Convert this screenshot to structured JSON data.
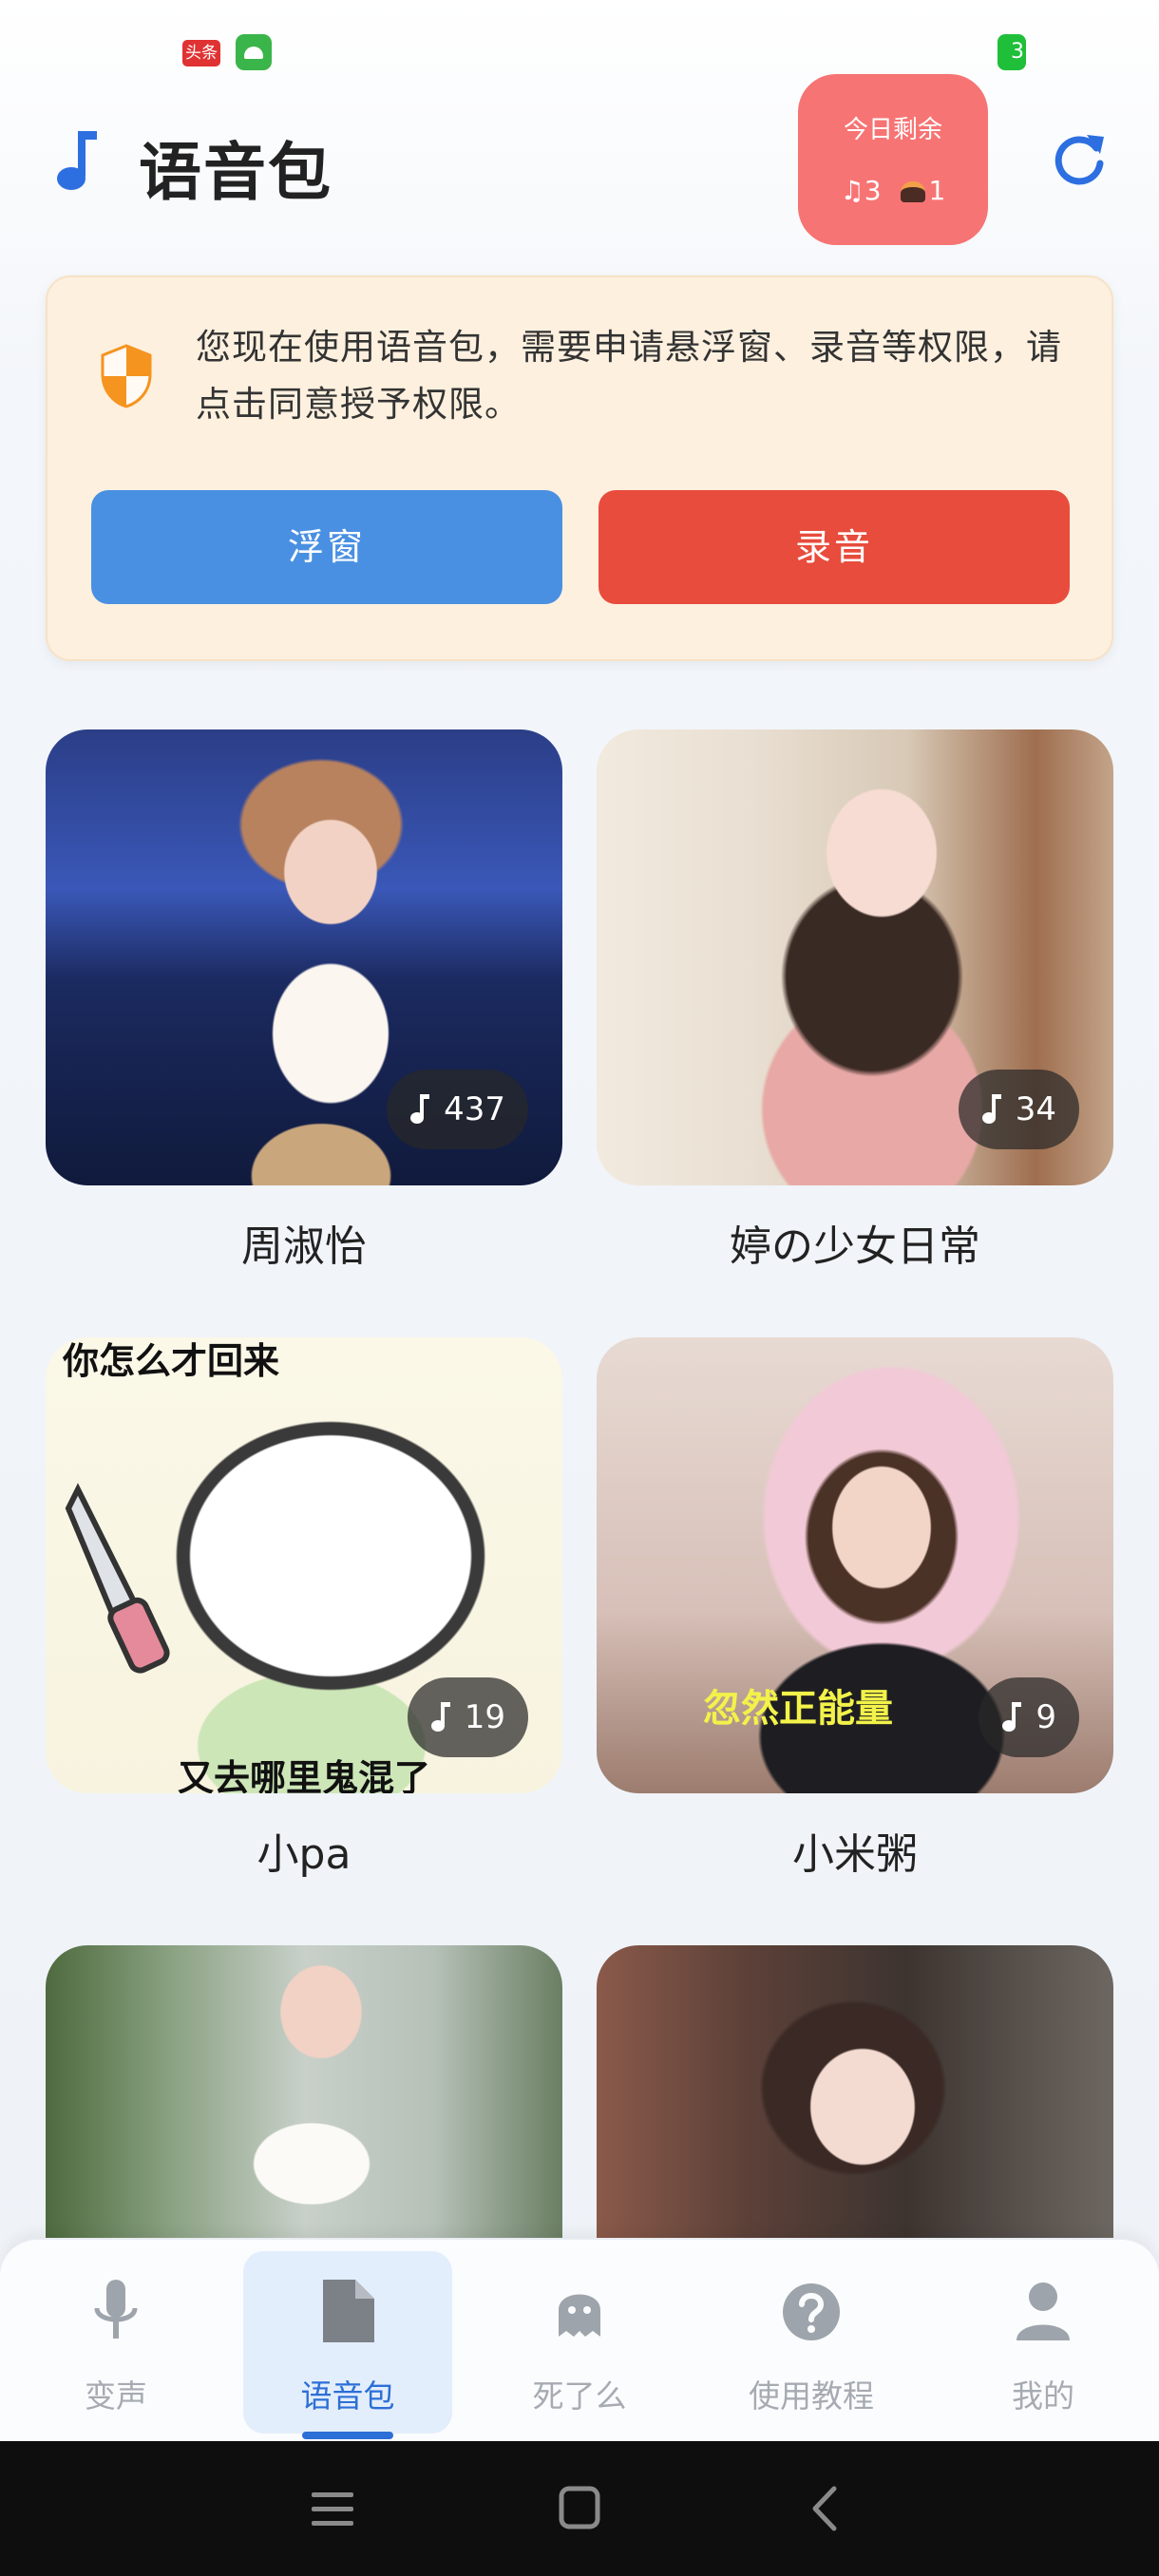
{
  "status_bar": {
    "badge_toutiao": "头条",
    "battery_level": "3"
  },
  "header": {
    "title": "语音包",
    "music_icon": "music-note-icon",
    "refresh_icon": "refresh-icon"
  },
  "quota": {
    "title": "今日剩余",
    "music_count": "3",
    "coin_count": "1"
  },
  "permission": {
    "message": "您现在使用语音包，需要申请悬浮窗、录音等权限，请点击同意授予权限。",
    "float_button": "浮窗",
    "record_button": "录音"
  },
  "cards": [
    {
      "name": "周淑怡",
      "count": "437"
    },
    {
      "name": "婷の少女日常",
      "count": "34"
    },
    {
      "name": "小pa",
      "count": "19",
      "overlay_top": "你怎么才回来",
      "overlay_bottom": "又去哪里鬼混了"
    },
    {
      "name": "小米粥",
      "count": "9",
      "overlay_caption": "忽然正能量"
    },
    {
      "name": ""
    },
    {
      "name": ""
    }
  ],
  "nav": {
    "items": [
      {
        "label": "变声",
        "icon": "microphone-icon"
      },
      {
        "label": "语音包",
        "icon": "file-icon"
      },
      {
        "label": "死了么",
        "icon": "ghost-icon"
      },
      {
        "label": "使用教程",
        "icon": "help-icon"
      },
      {
        "label": "我的",
        "icon": "person-icon"
      }
    ],
    "active_index": 1
  },
  "colors": {
    "accent": "#2c6fd6",
    "float_button": "#4a90e2",
    "record_button": "#e84c3d",
    "quota_badge": "#f77474",
    "permission_bg": "#fdf0df"
  }
}
